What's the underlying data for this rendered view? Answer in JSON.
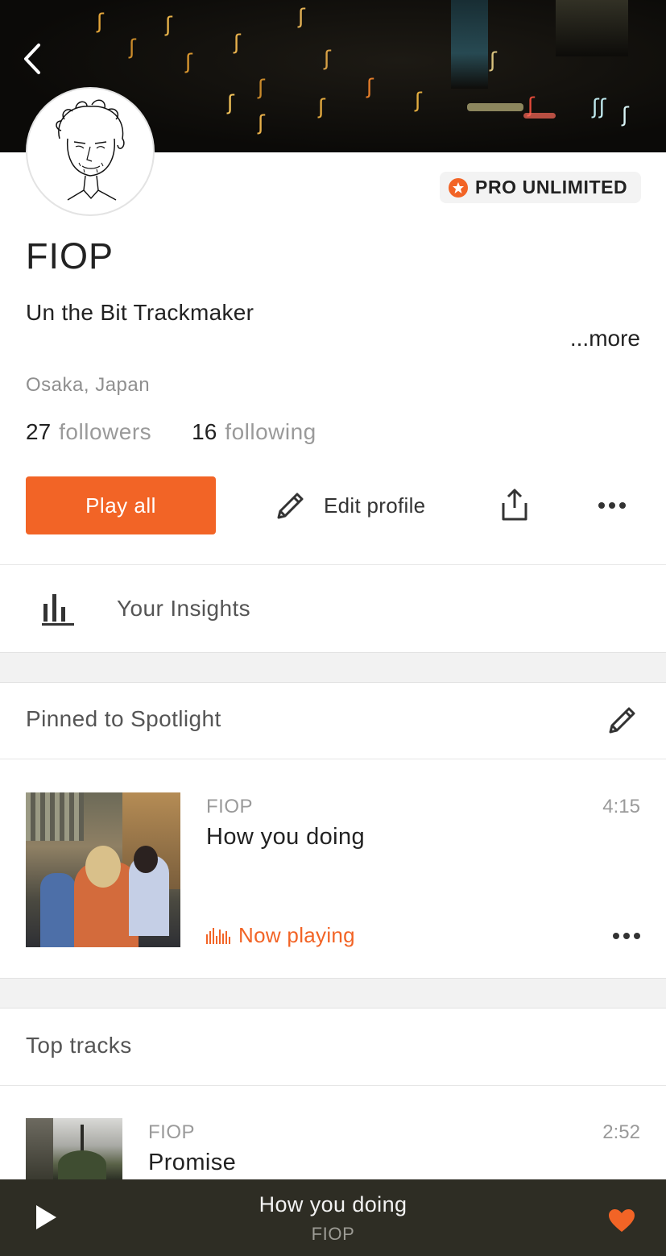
{
  "header": {
    "back_icon": "chevron-left-icon"
  },
  "profile": {
    "badge_label": "PRO UNLIMITED",
    "name": "FIOP",
    "bio": "Un the Bit Trackmaker",
    "more_link": "...more",
    "location": "Osaka, Japan",
    "followers_count": "27",
    "followers_label": "followers",
    "following_count": "16",
    "following_label": "following"
  },
  "actions": {
    "play_all_label": "Play all",
    "edit_profile_label": "Edit profile",
    "share_icon": "share-icon",
    "more_icon": "more-dots-icon"
  },
  "insights": {
    "label": "Your Insights",
    "icon": "bar-chart-icon"
  },
  "spotlight": {
    "title": "Pinned to Spotlight",
    "edit_icon": "pencil-icon",
    "track": {
      "artist": "FIOP",
      "title": "How you doing",
      "duration": "4:15",
      "status": "Now playing"
    }
  },
  "top_tracks": {
    "title": "Top tracks",
    "items": [
      {
        "artist": "FIOP",
        "title": "Promise",
        "duration": "2:52"
      }
    ]
  },
  "player": {
    "title": "How you doing",
    "artist": "FIOP",
    "play_icon": "play-icon",
    "like_icon": "heart-icon"
  },
  "colors": {
    "accent": "#f26426",
    "player_bg": "#2e2d24",
    "divider": "#e6e6e6",
    "muted_text": "#9a9a9a"
  }
}
